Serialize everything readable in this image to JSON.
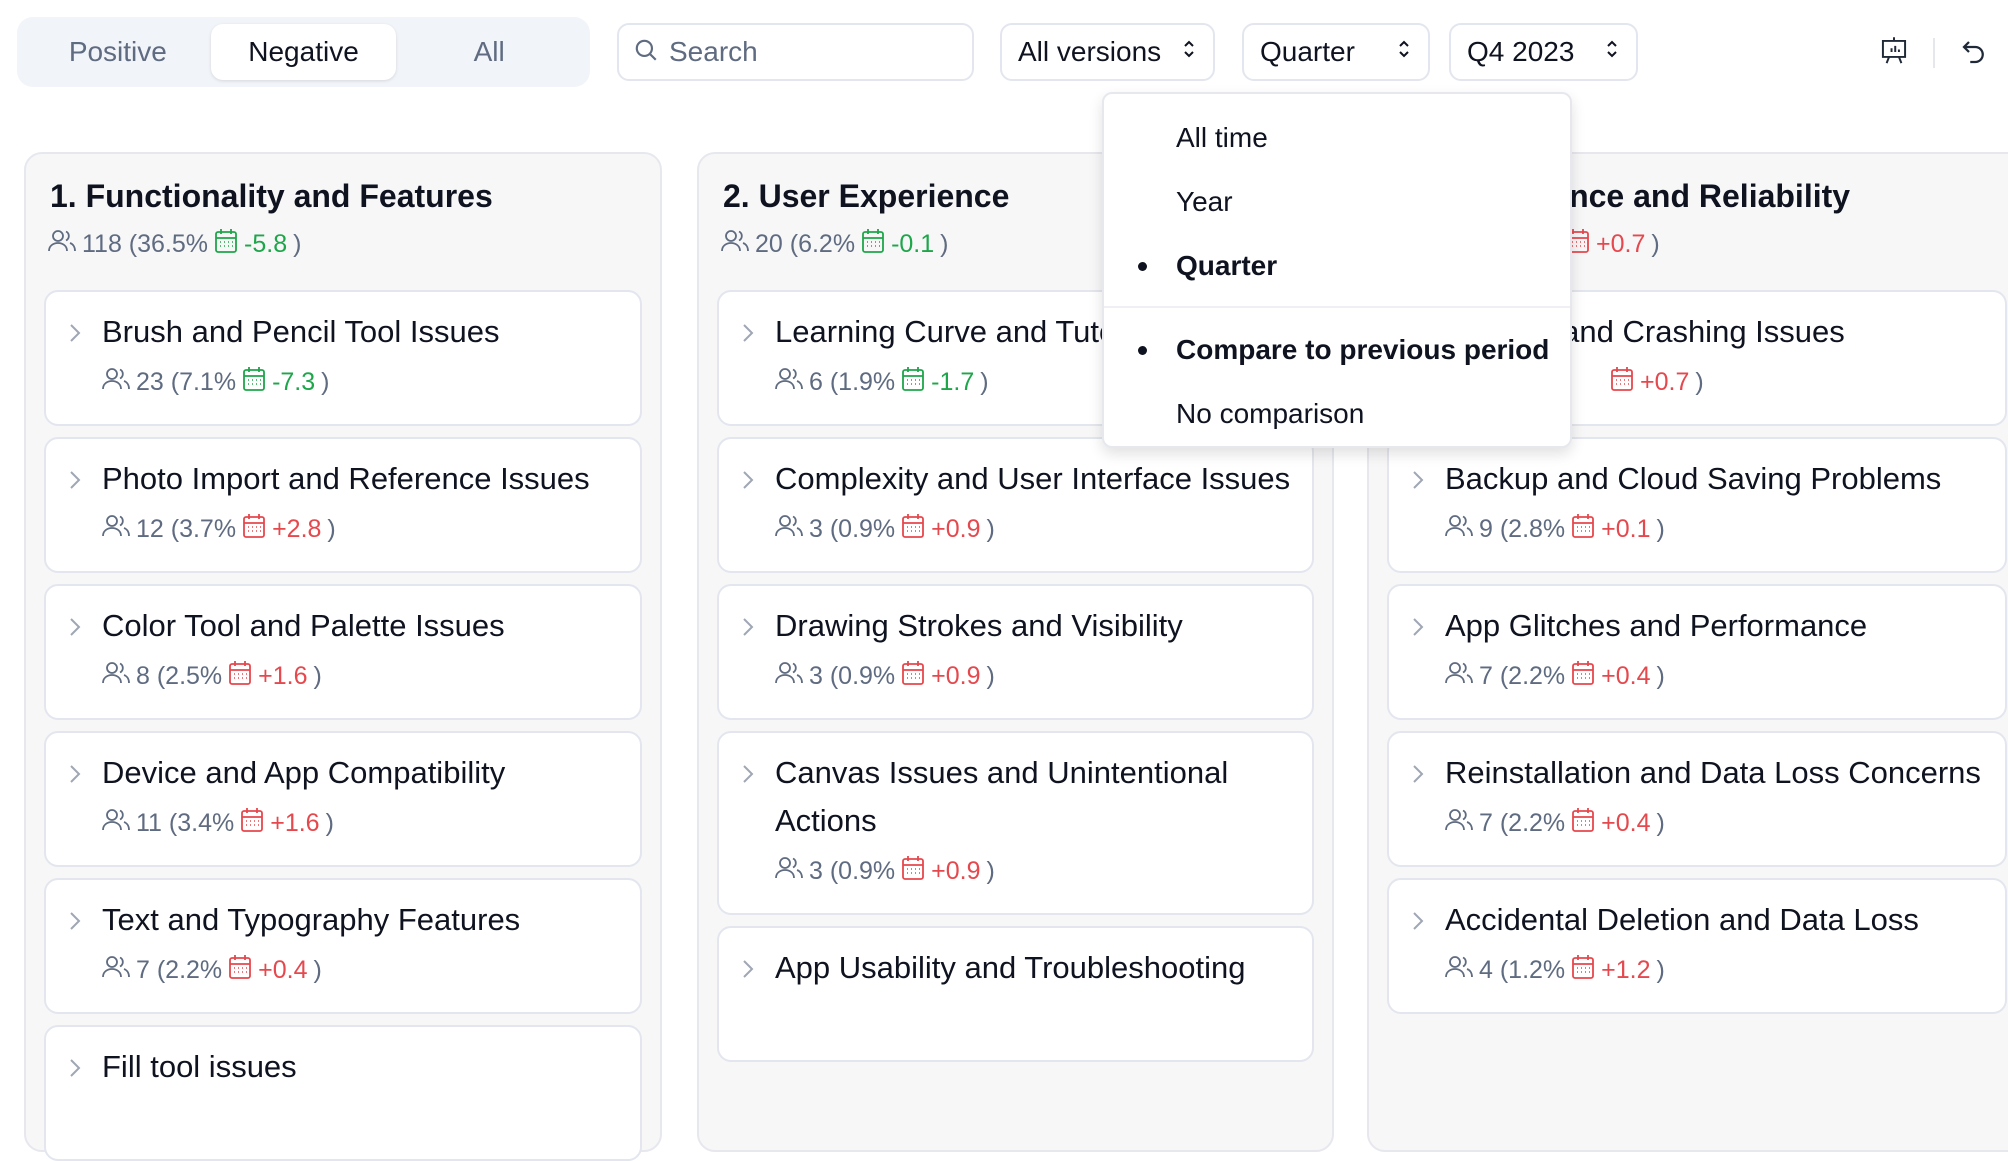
{
  "filter_tabs": [
    {
      "label": "Positive",
      "active": false
    },
    {
      "label": "Negative",
      "active": true
    },
    {
      "label": "All",
      "active": false
    }
  ],
  "search": {
    "placeholder": "Search",
    "value": ""
  },
  "selects": {
    "version": "All versions",
    "period": "Quarter",
    "quarter": "Q4 2023"
  },
  "toolbar": {
    "icons": [
      "presentation-chart-icon",
      "undo-icon"
    ]
  },
  "colors": {
    "increase": "#e5484d",
    "decrease": "#1ea64a",
    "muted": "#5f6b80"
  },
  "period_menu": {
    "period_options": [
      {
        "label": "All time",
        "selected": false
      },
      {
        "label": "Year",
        "selected": false
      },
      {
        "label": "Quarter",
        "selected": true
      }
    ],
    "comparison_options": [
      {
        "label": "Compare to previous period",
        "selected": true
      },
      {
        "label": "No comparison",
        "selected": false
      }
    ]
  },
  "columns": [
    {
      "title": "1. Functionality and Features",
      "count": "118 (36.5%",
      "delta": "-5.8",
      "items": [
        {
          "title": "Brush and Pencil Tool Issues",
          "count": "23 (7.1%",
          "delta": "-7.3"
        },
        {
          "title": "Photo Import and Reference Issues",
          "count": "12 (3.7%",
          "delta": "+2.8"
        },
        {
          "title": "Color Tool and Palette Issues",
          "count": "8 (2.5%",
          "delta": "+1.6"
        },
        {
          "title": "Device and App Compatibility",
          "count": "11 (3.4%",
          "delta": "+1.6"
        },
        {
          "title": "Text and Typography Features",
          "count": "7 (2.2%",
          "delta": "+0.4"
        },
        {
          "title": "Fill tool issues",
          "count": "",
          "delta": ""
        }
      ]
    },
    {
      "title": "2. User Experience",
      "count": "20 (6.2%",
      "delta": "-0.1",
      "items": [
        {
          "title": "Learning Curve and Tutorial Needs",
          "count": "6 (1.9%",
          "delta": "-1.7"
        },
        {
          "title": "Complexity and User Interface Issues",
          "count": "3 (0.9%",
          "delta": "+0.9"
        },
        {
          "title": "Drawing Strokes and Visibility",
          "count": "3 (0.9%",
          "delta": "+0.9"
        },
        {
          "title": "Canvas Issues and Unintentional Actions",
          "count": "3 (0.9%",
          "delta": "+0.9"
        },
        {
          "title": "App Usability and Troubleshooting",
          "count": "",
          "delta": ""
        }
      ]
    },
    {
      "title": "3. Performance and Reliability",
      "count": "",
      "delta": "+0.7",
      "items": [
        {
          "title": "Stability and Crashing Issues",
          "count": "",
          "delta": "+0.7"
        },
        {
          "title": "Backup and Cloud Saving Problems",
          "count": "9 (2.8%",
          "delta": "+0.1"
        },
        {
          "title": "App Glitches and Performance",
          "count": "7 (2.2%",
          "delta": "+0.4"
        },
        {
          "title": "Reinstallation and Data Loss Concerns",
          "count": "7 (2.2%",
          "delta": "+0.4"
        },
        {
          "title": "Accidental Deletion and Data Loss",
          "count": "4 (1.2%",
          "delta": "+1.2"
        }
      ]
    }
  ]
}
